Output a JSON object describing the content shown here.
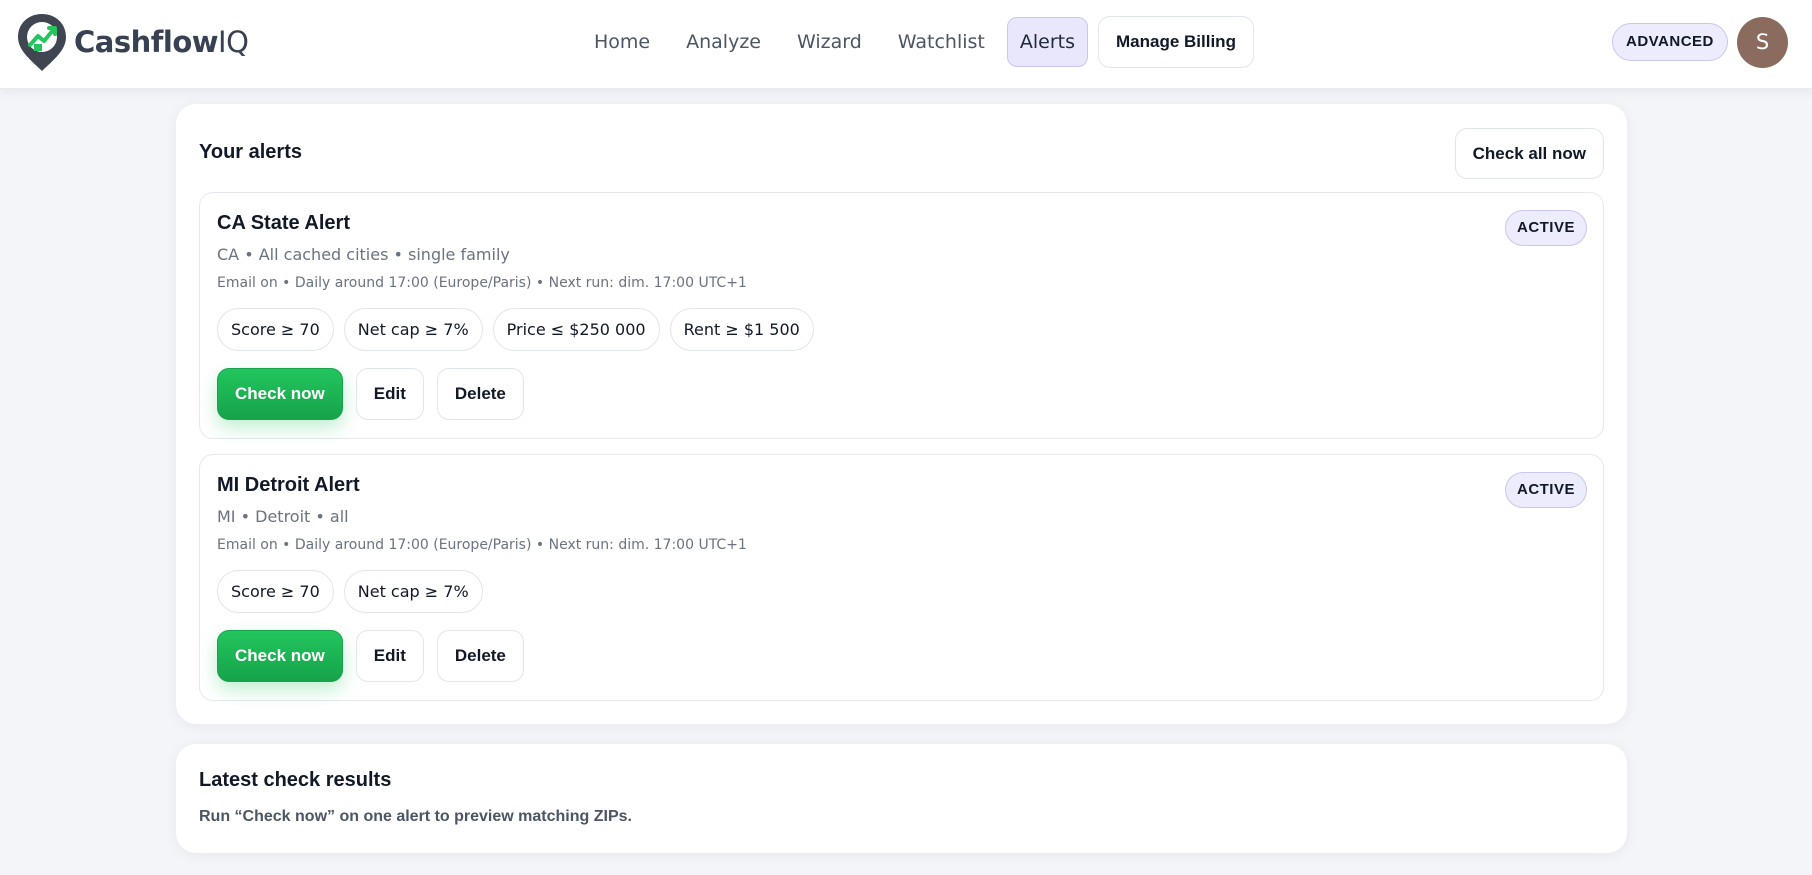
{
  "app": {
    "name_main": "Cashflow",
    "name_suffix": "IQ"
  },
  "nav": {
    "items": [
      {
        "label": "Home"
      },
      {
        "label": "Analyze"
      },
      {
        "label": "Wizard"
      },
      {
        "label": "Watchlist"
      },
      {
        "label": "Alerts"
      }
    ],
    "billing_label": "Manage Billing"
  },
  "header": {
    "plan_badge": "ADVANCED",
    "avatar_initial": "S"
  },
  "alerts_panel": {
    "title": "Your alerts",
    "check_all_label": "Check all now",
    "alerts": [
      {
        "name": "CA State Alert",
        "meta": "CA • All cached cities • single family",
        "schedule": "Email on • Daily around 17:00 (Europe/Paris) • Next run: dim. 17:00 UTC+1",
        "status": "ACTIVE",
        "filters": [
          "Score ≥ 70",
          "Net cap ≥ 7%",
          "Price ≤ $250 000",
          "Rent ≥ $1 500"
        ],
        "check_label": "Check now",
        "edit_label": "Edit",
        "delete_label": "Delete"
      },
      {
        "name": "MI Detroit Alert",
        "meta": "MI • Detroit • all",
        "schedule": "Email on • Daily around 17:00 (Europe/Paris) • Next run: dim. 17:00 UTC+1",
        "status": "ACTIVE",
        "filters": [
          "Score ≥ 70",
          "Net cap ≥ 7%"
        ],
        "check_label": "Check now",
        "edit_label": "Edit",
        "delete_label": "Delete"
      }
    ]
  },
  "results_panel": {
    "title": "Latest check results",
    "hint": "Run “Check now” on one alert to preview matching ZIPs."
  },
  "colors": {
    "accent_green": "#22c55e",
    "badge_bg": "#edecfc",
    "page_bg": "#f3f5f9"
  }
}
